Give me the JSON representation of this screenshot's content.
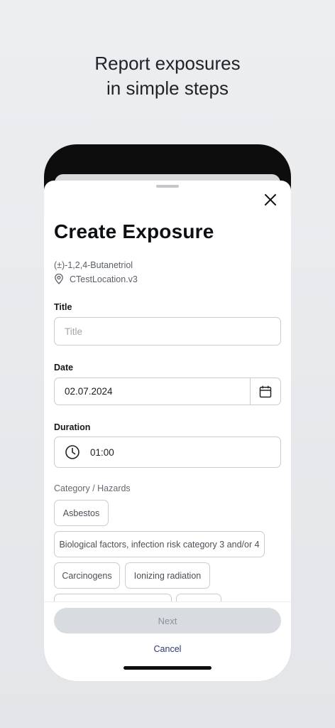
{
  "promo": {
    "line1": "Report exposures",
    "line2": "in simple steps"
  },
  "form": {
    "title": "Create Exposure",
    "substance": "(±)-1,2,4-Butanetriol",
    "location": "CTestLocation.v3",
    "title_label": "Title",
    "title_placeholder": "Title",
    "date_label": "Date",
    "date_value": "02.07.2024",
    "duration_label": "Duration",
    "duration_value": "01:00",
    "category_label": "Category / Hazards",
    "chips": {
      "asbestos": "Asbestos",
      "biological": "Biological factors, infection risk category 3 and/or 4",
      "carcinogens": "Carcinogens",
      "ionizing": "Ionizing radiation"
    },
    "next_label": "Next",
    "cancel_label": "Cancel"
  },
  "icons": {
    "close": "close-icon",
    "location": "location-pin-icon",
    "calendar": "calendar-icon",
    "clock": "clock-icon"
  },
  "colors": {
    "cancel": "#2b3a6b",
    "next_disabled_bg": "#d8dbdf",
    "next_disabled_text": "#8c9198"
  }
}
